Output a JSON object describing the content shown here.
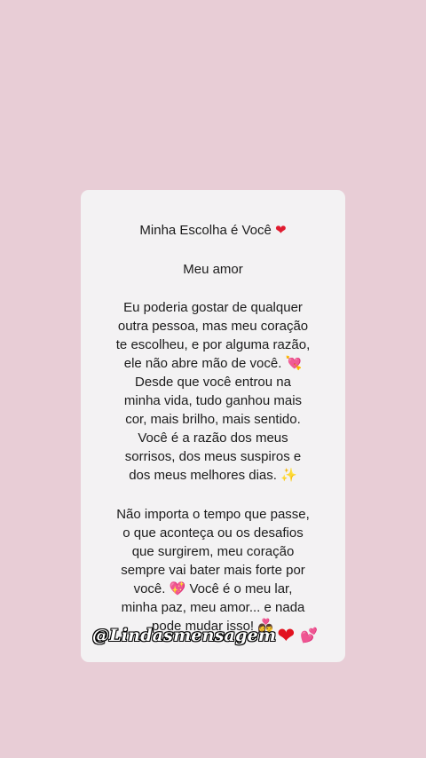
{
  "card": {
    "title": "Minha Escolha é Você",
    "title_emoji": "❤",
    "greeting": "Meu amor",
    "paragraph1": [
      "Eu poderia gostar de qualquer",
      "outra pessoa, mas meu coração",
      "te escolheu, e por alguma razão,",
      "ele não abre mão de você.",
      "Desde que você entrou na",
      "minha vida, tudo ganhou mais",
      "cor, mais brilho, mais sentido.",
      "Você é a razão dos meus",
      "sorrisos, dos meus suspiros e",
      "dos meus melhores dias."
    ],
    "paragraph1_emojis": {
      "line4": "💘",
      "line10": "✨"
    },
    "paragraph2": [
      "Não importa o tempo que passe,",
      "o que aconteça ou os desafios",
      "que surgirem, meu coração",
      "sempre vai bater mais forte por",
      "você.",
      "Você é o meu lar,",
      "minha paz, meu amor... e nada",
      "pode mudar isso!"
    ],
    "paragraph2_emojis": {
      "line5": "💖",
      "line8": "👩‍❤️‍👨"
    }
  },
  "watermark": {
    "handle": "@Lindasmensagem",
    "heart": "❤",
    "hearts": "💕"
  },
  "colors": {
    "background": "#e8cdd6",
    "card": "#f3f2f3",
    "text": "#1b1b1b",
    "heart": "#e01b2f"
  },
  "icons": [
    "red-heart-icon",
    "heart-arrow-icon",
    "sparkles-icon",
    "sparkling-heart-icon",
    "couple-heart-icon",
    "two-hearts-icon"
  ]
}
